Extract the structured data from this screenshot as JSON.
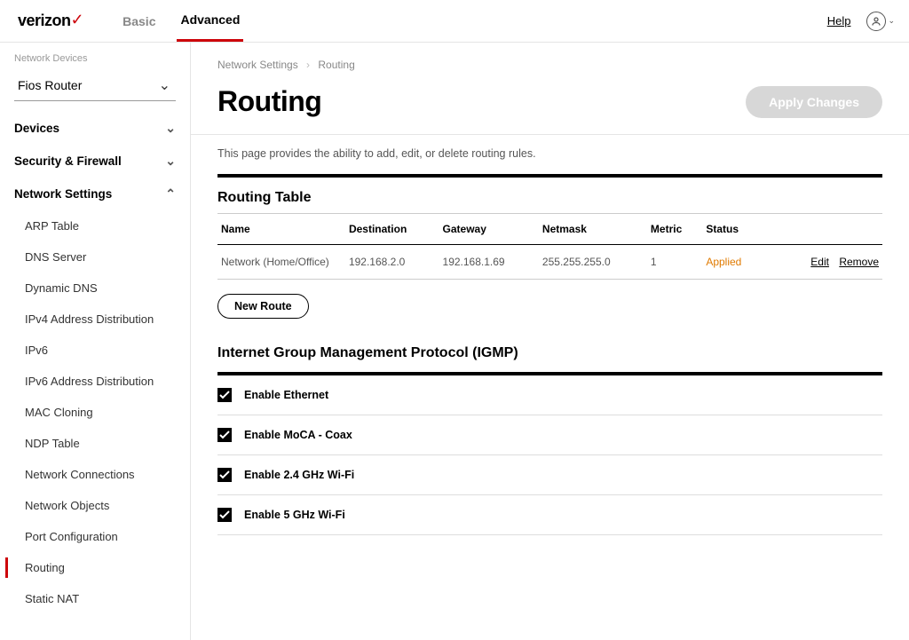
{
  "header": {
    "brand": "verizon",
    "tabs": {
      "basic": "Basic",
      "advanced": "Advanced"
    },
    "help": "Help"
  },
  "sidebar": {
    "label": "Network Devices",
    "device": "Fios Router",
    "sections": {
      "devices": "Devices",
      "security": "Security & Firewall",
      "network": "Network Settings"
    },
    "network_items": [
      "ARP Table",
      "DNS Server",
      "Dynamic DNS",
      "IPv4 Address Distribution",
      "IPv6",
      "IPv6 Address Distribution",
      "MAC Cloning",
      "NDP Table",
      "Network Connections",
      "Network Objects",
      "Port Configuration",
      "Routing",
      "Static NAT"
    ]
  },
  "breadcrumb": {
    "a": "Network Settings",
    "b": "Routing"
  },
  "page": {
    "title": "Routing",
    "apply": "Apply Changes",
    "desc": "This page provides the ability to add, edit, or delete routing rules."
  },
  "routing_table": {
    "title": "Routing Table",
    "headers": {
      "name": "Name",
      "dest": "Destination",
      "gw": "Gateway",
      "mask": "Netmask",
      "metric": "Metric",
      "status": "Status"
    },
    "row": {
      "name": "Network (Home/Office)",
      "dest": "192.168.2.0",
      "gw": "192.168.1.69",
      "mask": "255.255.255.0",
      "metric": "1",
      "status": "Applied",
      "edit": "Edit",
      "remove": "Remove"
    },
    "new_route": "New Route"
  },
  "igmp": {
    "title": "Internet Group Management Protocol (IGMP)",
    "items": [
      "Enable Ethernet",
      "Enable MoCA - Coax",
      "Enable 2.4 GHz Wi-Fi",
      "Enable 5 GHz Wi-Fi"
    ]
  }
}
